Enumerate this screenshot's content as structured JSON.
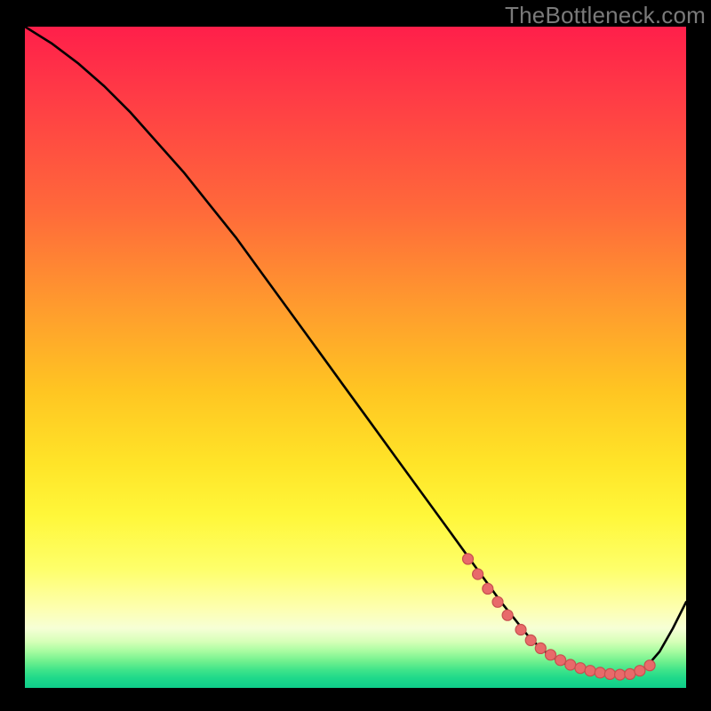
{
  "watermark": "TheBottleneck.com",
  "chart_data": {
    "type": "line",
    "title": "",
    "xlabel": "",
    "ylabel": "",
    "xlim": [
      0,
      100
    ],
    "ylim": [
      0,
      100
    ],
    "grid": false,
    "legend": false,
    "background": "vertical-rainbow-gradient",
    "series": [
      {
        "name": "bottleneck-curve",
        "x": [
          0,
          4,
          8,
          12,
          16,
          20,
          24,
          28,
          32,
          36,
          40,
          44,
          48,
          52,
          56,
          60,
          64,
          68,
          72,
          74,
          76,
          78,
          80,
          82,
          84,
          86,
          88,
          90,
          92,
          94,
          96,
          98,
          100
        ],
        "y": [
          100,
          97.5,
          94.5,
          91,
          87,
          82.5,
          78,
          73,
          68,
          62.5,
          57,
          51.5,
          46,
          40.5,
          35,
          29.5,
          24,
          18.5,
          13,
          10.5,
          8,
          6,
          4.5,
          3.5,
          2.8,
          2.3,
          2.0,
          2.0,
          2.2,
          3.2,
          5.5,
          9,
          13
        ]
      }
    ],
    "markers": {
      "name": "highlight-dots",
      "x": [
        67,
        68.5,
        70,
        71.5,
        73,
        75,
        76.5,
        78,
        79.5,
        81,
        82.5,
        84,
        85.5,
        87,
        88.5,
        90,
        91.5,
        93,
        94.5
      ],
      "y": [
        19.5,
        17.2,
        15,
        13,
        11,
        8.8,
        7.2,
        6,
        5,
        4.2,
        3.5,
        3.0,
        2.6,
        2.3,
        2.1,
        2.0,
        2.1,
        2.6,
        3.4
      ]
    },
    "colors": {
      "curve": "#000000",
      "dots": "#e86a6a",
      "gradient_top": "#ff1f4a",
      "gradient_mid": "#ffe428",
      "gradient_bottom": "#0fce8a"
    }
  }
}
